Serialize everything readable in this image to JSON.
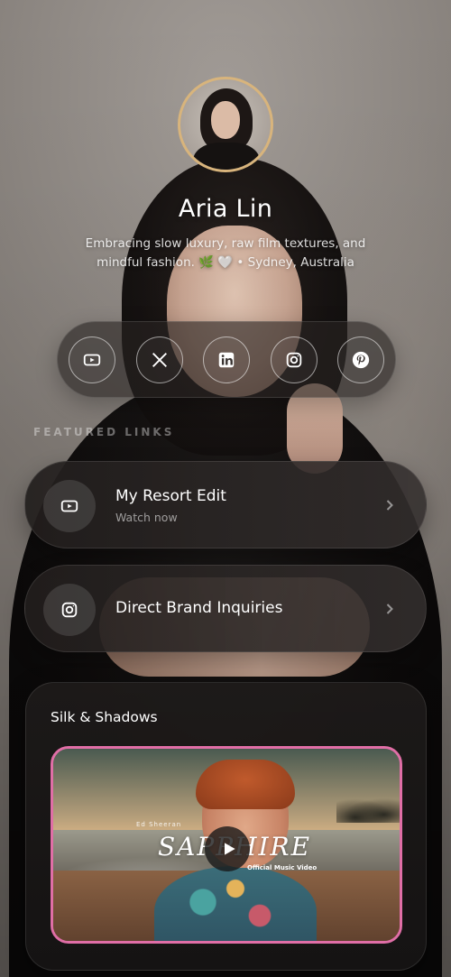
{
  "profile": {
    "name": "Aria Lin",
    "bio": "Embracing slow luxury, raw film textures, and mindful fashion. 🌿 🤍 • Sydney, Australia"
  },
  "social": [
    {
      "name": "youtube-icon",
      "label": "YouTube"
    },
    {
      "name": "x-icon",
      "label": "X"
    },
    {
      "name": "linkedin-icon",
      "label": "LinkedIn"
    },
    {
      "name": "instagram-icon",
      "label": "Instagram"
    },
    {
      "name": "pinterest-icon",
      "label": "Pinterest"
    }
  ],
  "featured": {
    "label": "FEATURED LINKS",
    "links": [
      {
        "title": "My Resort Edit",
        "subtitle": "Watch now",
        "icon": "youtube-icon"
      },
      {
        "title": "Direct Brand Inquiries",
        "icon": "instagram-icon"
      }
    ]
  },
  "video": {
    "title": "Silk & Shadows",
    "thumb_artist": "Ed Sheeran",
    "thumb_title": "SAPPHIRE",
    "thumb_subtitle": "Official Music Video"
  },
  "colors": {
    "avatar_ring": "#d8b47c",
    "video_border": "#e06ea6"
  }
}
